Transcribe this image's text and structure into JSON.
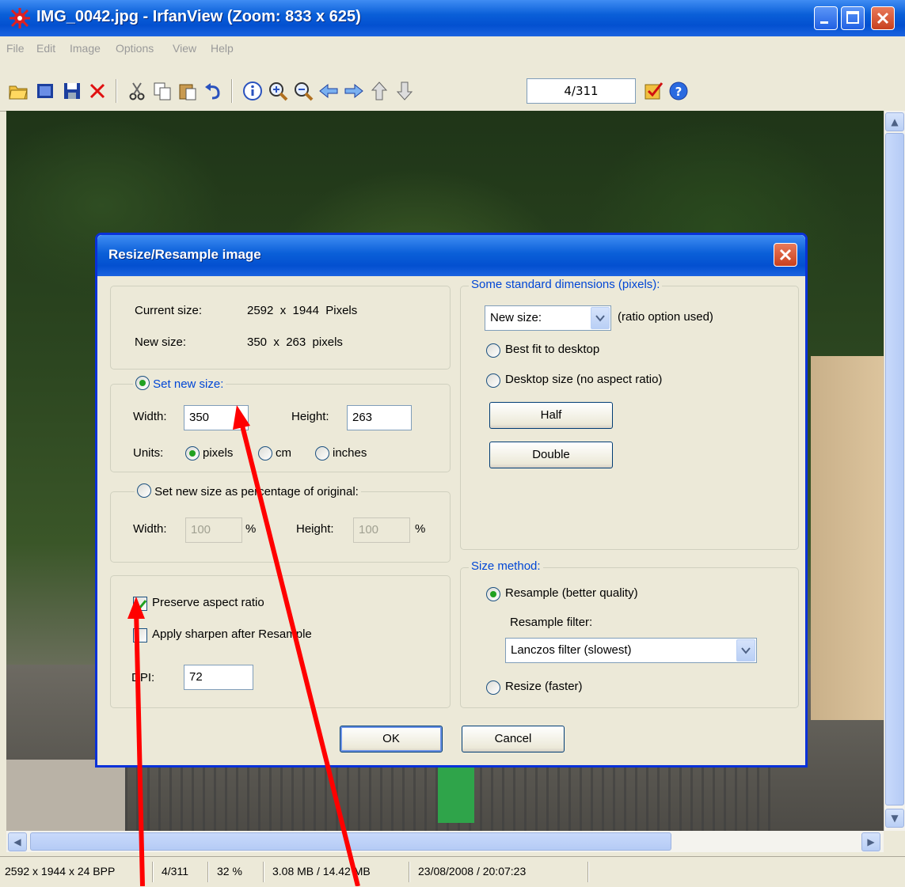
{
  "window": {
    "title": "IMG_0042.jpg - IrfanView (Zoom: 833 x 625)",
    "menu": [
      "File",
      "Edit",
      "Image",
      "Options",
      "View",
      "Help"
    ]
  },
  "toolbar": {
    "icons": [
      "open-icon",
      "slideshow-icon",
      "save-icon",
      "delete-icon",
      "cut-icon",
      "copy-icon",
      "paste-icon",
      "undo-icon",
      "info-icon",
      "zoom-in-icon",
      "zoom-out-icon",
      "previous-icon",
      "next-icon",
      "first-icon",
      "last-icon",
      "properties-icon",
      "help-icon"
    ],
    "page_counter": "4/311"
  },
  "status": {
    "image_info": "2592 x 1944 x 24 BPP",
    "page": "4/311",
    "zoom": "32 %",
    "file_size": "3.08 MB / 14.42 MB",
    "date": "23/08/2008 / 20:07:23"
  },
  "dialog": {
    "title": "Resize/Resample image",
    "info": {
      "current_label": "Current size:",
      "current_value": "2592  x  1944  Pixels",
      "new_label": "New size:",
      "new_value": "350  x  263  pixels"
    },
    "set_new_size": {
      "legend": "Set new size:",
      "width_label": "Width:",
      "width_value": "350",
      "height_label": "Height:",
      "height_value": "263",
      "units_label": "Units:",
      "units": [
        "pixels",
        "cm",
        "inches"
      ],
      "selected_unit": "pixels"
    },
    "percentage": {
      "legend": "Set new size as percentage of original:",
      "width_label": "Width:",
      "width_value": "100",
      "height_label": "Height:",
      "height_value": "100",
      "unit": "%"
    },
    "options": {
      "preserve_label": "Preserve aspect ratio",
      "preserve_checked": true,
      "sharpen_label": "Apply sharpen after Resample",
      "sharpen_checked": false,
      "dpi_label": "DPI:",
      "dpi_value": "72"
    },
    "standard": {
      "legend": "Some standard dimensions (pixels):",
      "select_value": "New size:",
      "ratio_note": "(ratio option used)",
      "best_fit": "Best fit to desktop",
      "desktop_size": "Desktop size (no aspect ratio)",
      "half": "Half",
      "double": "Double"
    },
    "method": {
      "legend": "Size method:",
      "resample": "Resample (better quality)",
      "filter_label": "Resample filter:",
      "filter_value": "Lanczos filter (slowest)",
      "resize": "Resize (faster)"
    },
    "ok": "OK",
    "cancel": "Cancel"
  },
  "colors": {
    "xp_blue": "#0a5fd8",
    "group_legend": "#0046d5",
    "annotation": "#ff0000"
  }
}
